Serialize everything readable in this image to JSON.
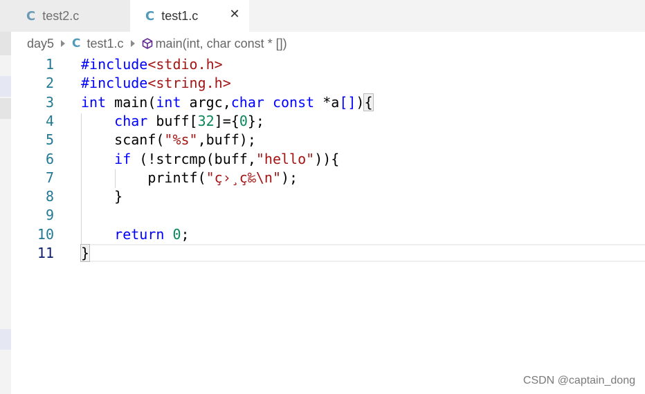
{
  "tabs": [
    {
      "icon": "C",
      "label": "test2.c"
    },
    {
      "icon": "C",
      "label": "test1.c",
      "close": "✕"
    }
  ],
  "breadcrumb": {
    "folder": "day5",
    "file_icon": "C",
    "file": "test1.c",
    "symbol": "main(int, char const * [])"
  },
  "editor": {
    "line_numbers": [
      "1",
      "2",
      "3",
      "4",
      "5",
      "6",
      "7",
      "8",
      "9",
      "10",
      "11"
    ],
    "current_line": "11",
    "lines": [
      [
        {
          "t": "#include",
          "c": "pp"
        },
        {
          "t": "<stdio.h>",
          "c": "str"
        }
      ],
      [
        {
          "t": "#include",
          "c": "pp"
        },
        {
          "t": "<string.h>",
          "c": "str"
        }
      ],
      [
        {
          "t": "int",
          "c": "kw"
        },
        {
          "t": " main(",
          "c": ""
        },
        {
          "t": "int",
          "c": "kw"
        },
        {
          "t": " argc,",
          "c": ""
        },
        {
          "t": "char",
          "c": "kw"
        },
        {
          "t": " ",
          "c": ""
        },
        {
          "t": "const",
          "c": "kw"
        },
        {
          "t": " *a",
          "c": ""
        },
        {
          "t": "[]",
          "c": "kw"
        },
        {
          "t": ")",
          "c": ""
        },
        {
          "t": "{",
          "c": "br-hl"
        }
      ],
      [
        {
          "t": "    ",
          "c": ""
        },
        {
          "t": "char",
          "c": "kw"
        },
        {
          "t": " buff[",
          "c": ""
        },
        {
          "t": "32",
          "c": "num"
        },
        {
          "t": "]={",
          "c": ""
        },
        {
          "t": "0",
          "c": "num"
        },
        {
          "t": "};",
          "c": ""
        }
      ],
      [
        {
          "t": "    scanf(",
          "c": ""
        },
        {
          "t": "\"%s\"",
          "c": "str"
        },
        {
          "t": ",buff);",
          "c": ""
        }
      ],
      [
        {
          "t": "    ",
          "c": ""
        },
        {
          "t": "if",
          "c": "kw"
        },
        {
          "t": " (!strcmp(buff,",
          "c": ""
        },
        {
          "t": "\"hello\"",
          "c": "str"
        },
        {
          "t": ")){",
          "c": ""
        }
      ],
      [
        {
          "t": "        printf(",
          "c": ""
        },
        {
          "t": "\"ç›¸ç‰\\n\"",
          "c": "str"
        },
        {
          "t": ");",
          "c": ""
        }
      ],
      [
        {
          "t": "    }",
          "c": ""
        }
      ],
      [],
      [
        {
          "t": "    ",
          "c": ""
        },
        {
          "t": "return",
          "c": "kw"
        },
        {
          "t": " ",
          "c": ""
        },
        {
          "t": "0",
          "c": "num"
        },
        {
          "t": ";",
          "c": ""
        }
      ],
      [
        {
          "t": "}",
          "c": "br-hl"
        }
      ]
    ]
  },
  "watermark": "CSDN @captain_dong",
  "colors": {
    "keyword": "#0000ff",
    "string": "#a31515",
    "number": "#098658",
    "line_number": "#237893",
    "c_icon": "#519aba"
  }
}
